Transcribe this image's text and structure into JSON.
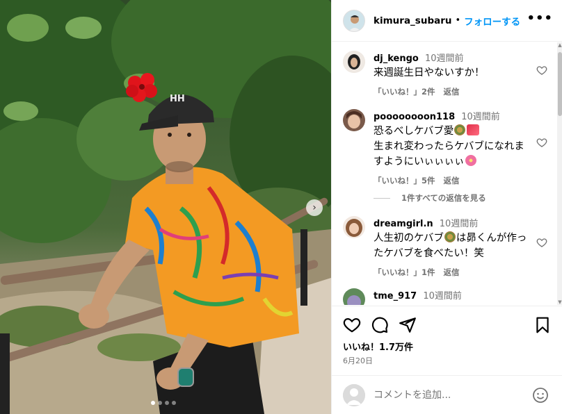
{
  "header": {
    "username": "kimura_subaru",
    "separator": "•",
    "follow_label": "フォローする",
    "more_label": "•••"
  },
  "comments": [
    {
      "username": "dj_kengo",
      "time": "10週間前",
      "text": "来週誕生日やないすか！",
      "like_label": "「いいね！」2件",
      "reply_label": "返信"
    },
    {
      "username": "poooooooon118",
      "time": "10週間前",
      "text_line1": "恐るべしケバブ愛",
      "text_line2": "生まれ変わったらケバブになれますようにいぃぃぃぃ",
      "like_label": "「いいね！」5件",
      "reply_label": "返信",
      "view_replies": "1件すべての返信を見る"
    },
    {
      "username": "dreamgirl.n",
      "time": "10週間前",
      "text_line1": "人生初のケバブ",
      "text_line2": "は昴くんが作ったケバブを食べたい！笑",
      "like_label": "「いいね！」1件",
      "reply_label": "返信"
    },
    {
      "username": "tme_917",
      "time": "10週間前"
    }
  ],
  "footer": {
    "likes": "いいね！1.7万件",
    "date": "6月20日",
    "comment_placeholder": "コメントを追加..."
  },
  "carousel": {
    "total": 4,
    "active_index": 1
  },
  "colors": {
    "accent": "#0095f6",
    "muted": "#737373",
    "border": "#efefef"
  },
  "icons": [
    "more-icon",
    "heart-icon",
    "comment-icon",
    "share-icon",
    "bookmark-icon",
    "emoji-icon",
    "chevron-right-icon"
  ]
}
